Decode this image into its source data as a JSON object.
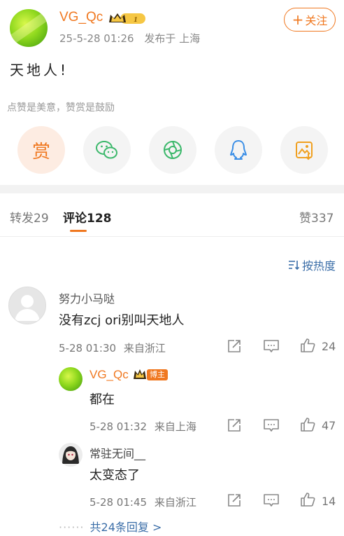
{
  "post": {
    "username": "VG_Qc",
    "level_badge": "1",
    "date": "25-5-28 01:26",
    "location": "发布于 上海",
    "follow_label": "关注",
    "follow_plus": "+",
    "text": "天地人!"
  },
  "reward": {
    "hint": "点赞是美意，赞赏是鼓励",
    "main_label": "赏",
    "share_icons": [
      "wechat-icon",
      "moments-icon",
      "qq-icon",
      "save-image-icon"
    ]
  },
  "tabs": {
    "repost": "转发",
    "repost_count": "29",
    "comment": "评论",
    "comment_count": "128",
    "like": "赞",
    "like_count": "337",
    "sort_label": "按热度"
  },
  "comments": [
    {
      "name": "努力小马哒",
      "text": "没有zcj ori别叫天地人",
      "date": "5-28 01:30",
      "location": "来自浙江",
      "likes": "24",
      "replies": [
        {
          "name": "VG_Qc",
          "badge": "博主",
          "text": "都在",
          "date": "5-28 01:32",
          "location": "来自上海",
          "likes": "47"
        },
        {
          "name": "常驻无间__",
          "text": "太变态了",
          "date": "5-28 01:45",
          "location": "来自浙江",
          "likes": "14"
        }
      ],
      "more_replies": "共24条回复 >"
    }
  ],
  "colors": {
    "accent": "#f07820",
    "link": "#3b6ea8",
    "divider": "#f2f2f2"
  }
}
